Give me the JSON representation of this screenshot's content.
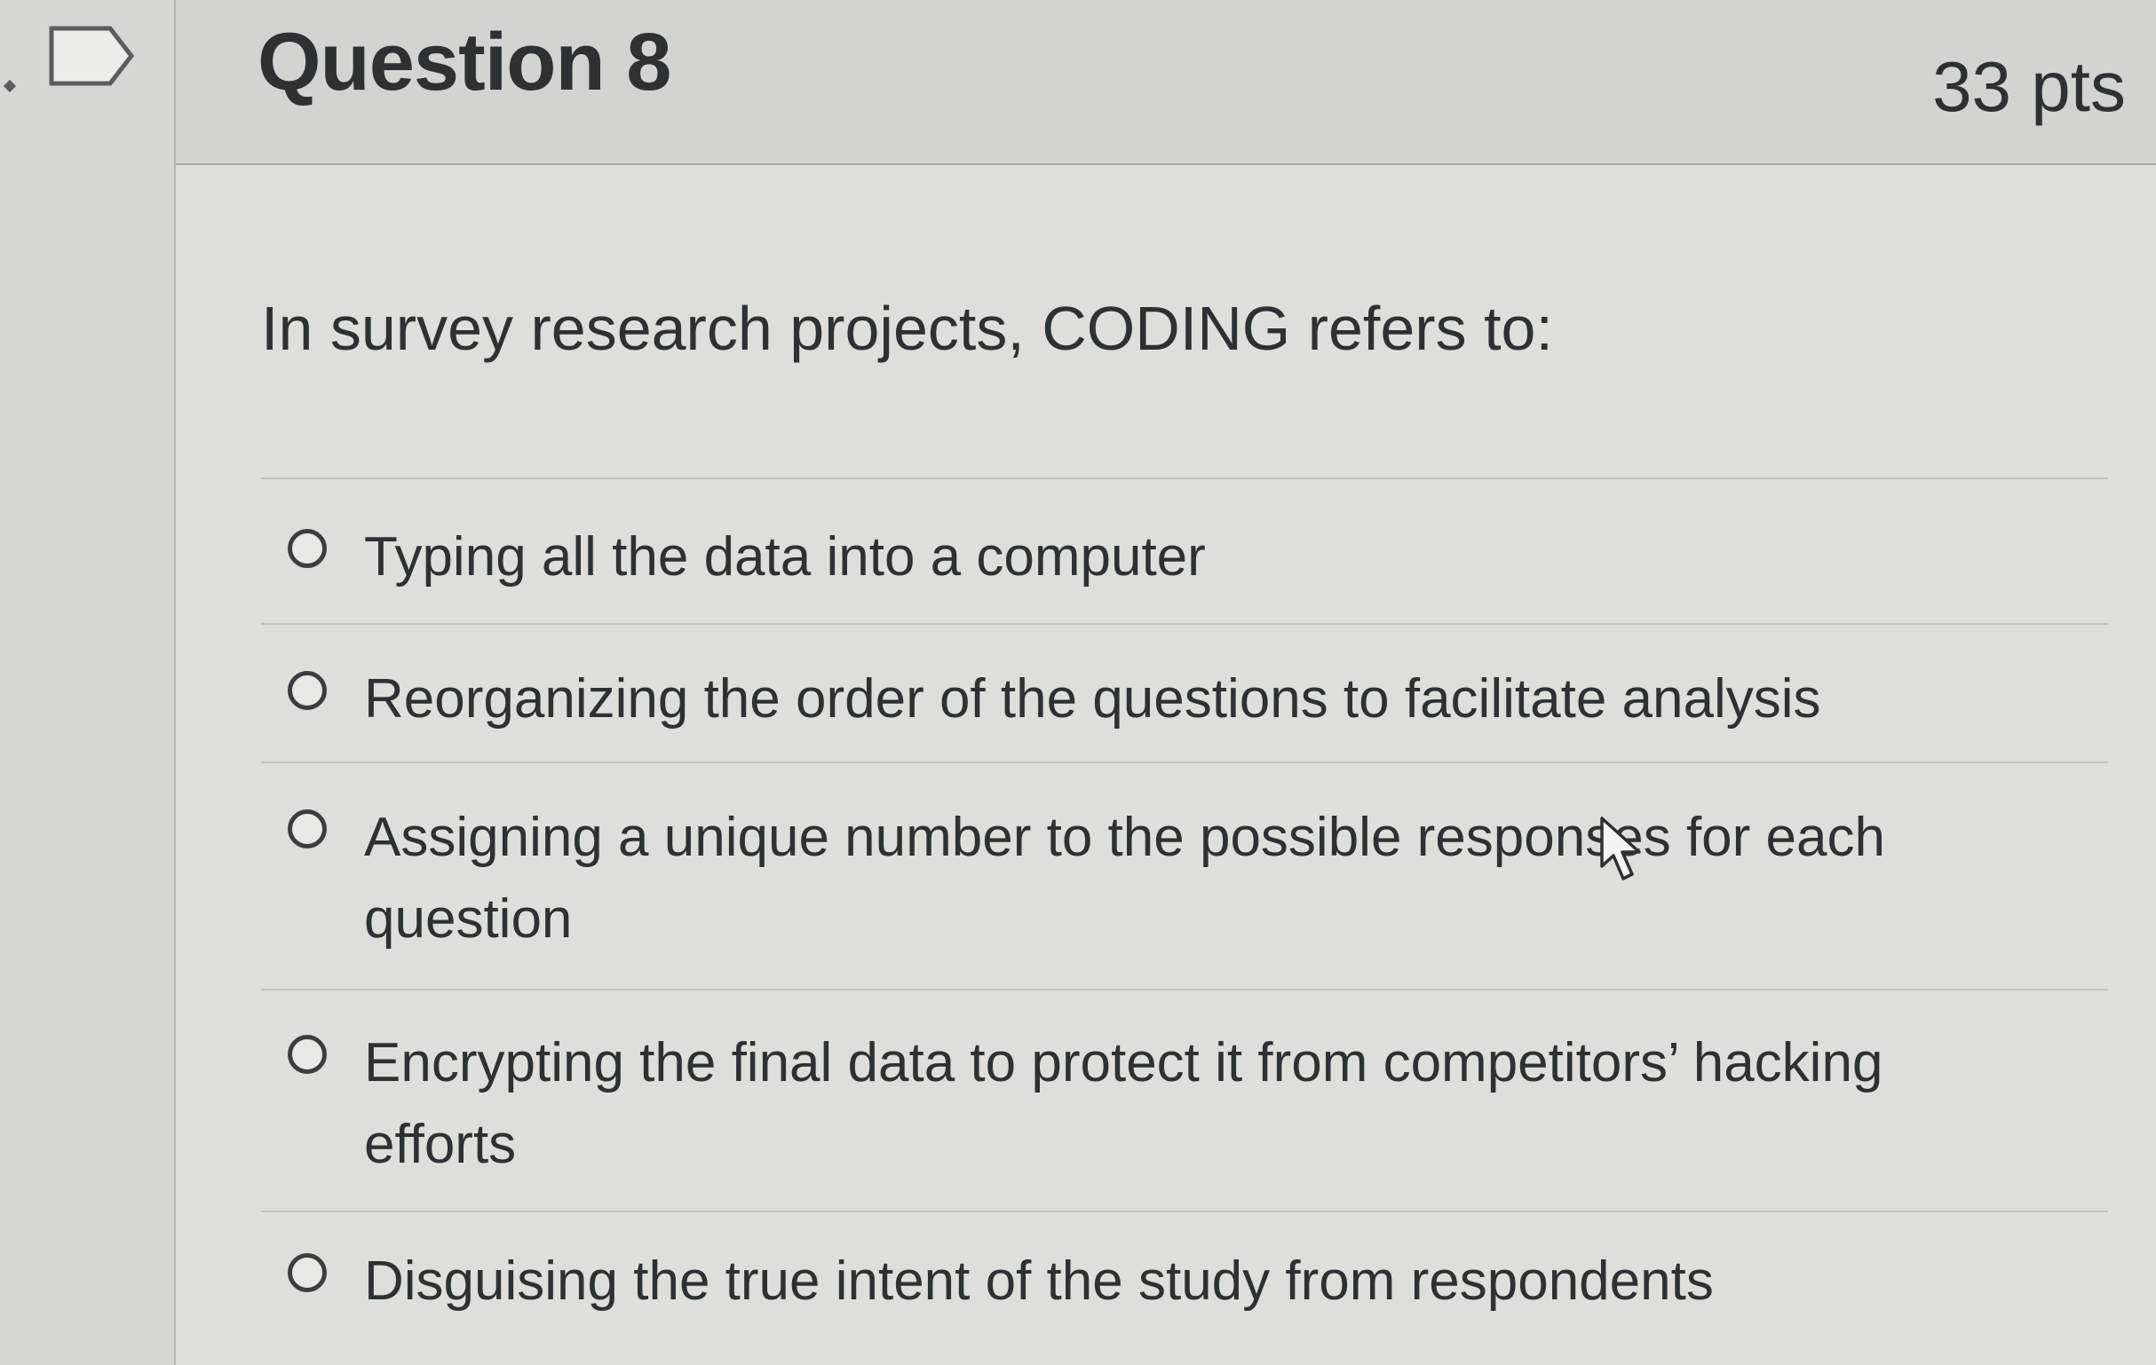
{
  "question": {
    "title": "Question 8",
    "points": "33 pts",
    "prompt": "In survey research projects, CODING refers to:"
  },
  "answers": [
    {
      "label": "Typing all the data into a computer"
    },
    {
      "label": "Reorganizing the order of the questions to facilitate analysis"
    },
    {
      "label": "Assigning a unique number to the possible responses for each question"
    },
    {
      "label": "Encrypting the final data to protect it from competitors’ hacking efforts"
    },
    {
      "label": "Disguising the true intent of the study from respondents"
    }
  ],
  "icons": {
    "flag": "flag-outline-icon",
    "cursor": "mouse-pointer-icon"
  },
  "colors": {
    "text": "#2e3133",
    "background": "#dededb",
    "header": "#d3d3d1"
  }
}
